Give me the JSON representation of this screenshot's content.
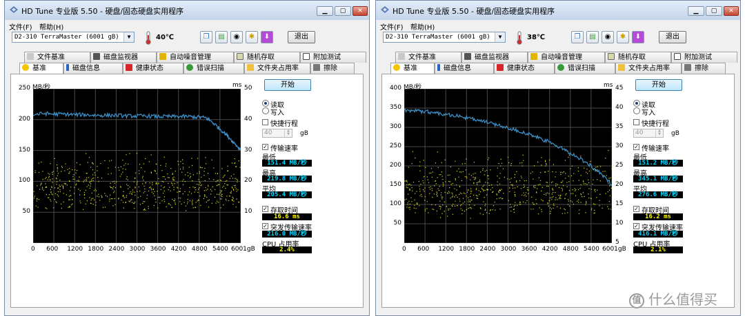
{
  "colors": {
    "read_line": "#3e95d0",
    "access_dots": "#e1e02a",
    "grid": "#4a4a4a",
    "plot_bg": "#000000",
    "value_cyan": "#00d7ff",
    "value_yellow": "#ffff00"
  },
  "windows": [
    {
      "title": "HD Tune 专业版 5.50 - 硬盘/固态硬盘实用程序",
      "menu": [
        "文件(F)",
        "帮助(H)"
      ],
      "drive": "D2-310  TerraMaster (6001 gB)",
      "temperature": "40℃",
      "exit_label": "退出",
      "tabs_top": [
        "文件基准",
        "磁盘监视器",
        "自动噪音管理",
        "随机存取",
        "附加测试"
      ],
      "tabs_bottom": [
        "基准",
        "磁盘信息",
        "健康状态",
        "错误扫描",
        "文件夹占用率",
        "擦除"
      ],
      "active_tab": "基准",
      "axis": {
        "y_unit": "MB/秒",
        "ms_unit": "ms",
        "y_ticks": [
          "250",
          "200",
          "150",
          "100",
          "50"
        ],
        "ms_ticks": [
          "50",
          "40",
          "30",
          "20",
          "10"
        ],
        "x_ticks": [
          "0",
          "600",
          "1200",
          "1800",
          "2400",
          "3000",
          "3600",
          "4200",
          "4800",
          "5400",
          "6001gB"
        ]
      },
      "start_label": "开始",
      "read_label": "读取",
      "write_label": "写入",
      "short_stroke_label": "快捷行程",
      "short_stroke_value": "40",
      "short_stroke_unit": "gB",
      "transfer_label": "传输速率",
      "min_label": "最低",
      "min_value": "151.4 MB/秒",
      "max_label": "最高",
      "max_value": "219.8 MB/秒",
      "avg_label": "平均",
      "avg_value": "205.4 MB/秒",
      "access_label": "存取时间",
      "access_value": "16.6 ms",
      "burst_label": "突发传输速率",
      "burst_value": "216.0 MB/秒",
      "cpu_label": "CPU 占用率",
      "cpu_value": "2.4%"
    },
    {
      "title": "HD Tune 专业版 5.50 - 硬盘/固态硬盘实用程序",
      "menu": [
        "文件(F)",
        "帮助(H)"
      ],
      "drive": "D2-310  TerraMaster (6001 gB)",
      "temperature": "38℃",
      "exit_label": "退出",
      "tabs_top": [
        "文件基准",
        "磁盘监视器",
        "自动噪音管理",
        "随机存取",
        "附加测试"
      ],
      "tabs_bottom": [
        "基准",
        "磁盘信息",
        "健康状态",
        "错误扫描",
        "文件夹占用率",
        "擦除"
      ],
      "active_tab": "基准",
      "axis": {
        "y_unit": "MB/秒",
        "ms_unit": "ms",
        "y_ticks": [
          "400",
          "350",
          "300",
          "250",
          "200",
          "150",
          "100",
          "50"
        ],
        "ms_ticks": [
          "45",
          "40",
          "35",
          "30",
          "25",
          "20",
          "15",
          "10",
          "5"
        ],
        "x_ticks": [
          "0",
          "600",
          "1200",
          "1800",
          "2400",
          "3000",
          "3600",
          "4200",
          "4800",
          "5400",
          "6001gB"
        ]
      },
      "start_label": "开始",
      "read_label": "读取",
      "write_label": "写入",
      "short_stroke_label": "快捷行程",
      "short_stroke_value": "40",
      "short_stroke_unit": "gB",
      "transfer_label": "传输速率",
      "min_label": "最低",
      "min_value": "151.2 MB/秒",
      "max_label": "最高",
      "max_value": "345.1 MB/秒",
      "avg_label": "平均",
      "avg_value": "276.6 MB/秒",
      "access_label": "存取时间",
      "access_value": "16.2 ms",
      "burst_label": "突发传输速率",
      "burst_value": "416.1 MB/秒",
      "cpu_label": "CPU 占用率",
      "cpu_value": "2.1%"
    }
  ],
  "watermark": {
    "icon": "值",
    "text": "什么值得买"
  },
  "chart_data": [
    {
      "type": "line",
      "title": "",
      "xlabel": "gB",
      "ylabel": "MB/秒",
      "y2label": "ms",
      "xlim": [
        0,
        6001
      ],
      "ylim": [
        0,
        250
      ],
      "y2lim": [
        0,
        50
      ],
      "grid": true,
      "series": [
        {
          "x": [
            0,
            300,
            600,
            900,
            1200,
            1500,
            1800,
            2100,
            2400,
            2700,
            3000,
            3300,
            3600,
            3900,
            4200,
            4500,
            4800,
            5000,
            5200,
            5400,
            5600,
            5800,
            6001
          ],
          "values": [
            208,
            210,
            209,
            209,
            208,
            208,
            207,
            207,
            207,
            206,
            206,
            206,
            205,
            205,
            205,
            205,
            204,
            203,
            195,
            185,
            175,
            163,
            151
          ]
        }
      ],
      "access_time_ms_range": [
        8,
        28
      ]
    },
    {
      "type": "line",
      "title": "",
      "xlabel": "gB",
      "ylabel": "MB/秒",
      "y2label": "ms",
      "xlim": [
        0,
        6001
      ],
      "ylim": [
        0,
        400
      ],
      "y2lim": [
        0,
        50
      ],
      "grid": true,
      "series": [
        {
          "x": [
            0,
            300,
            600,
            900,
            1200,
            1500,
            1800,
            2100,
            2400,
            2700,
            3000,
            3300,
            3600,
            3900,
            4200,
            4500,
            4800,
            5100,
            5400,
            5700,
            6001
          ],
          "values": [
            345,
            343,
            341,
            338,
            334,
            330,
            325,
            319,
            313,
            306,
            299,
            291,
            282,
            272,
            261,
            248,
            234,
            218,
            200,
            178,
            152
          ]
        }
      ],
      "access_time_ms_range": [
        6,
        28
      ]
    }
  ]
}
